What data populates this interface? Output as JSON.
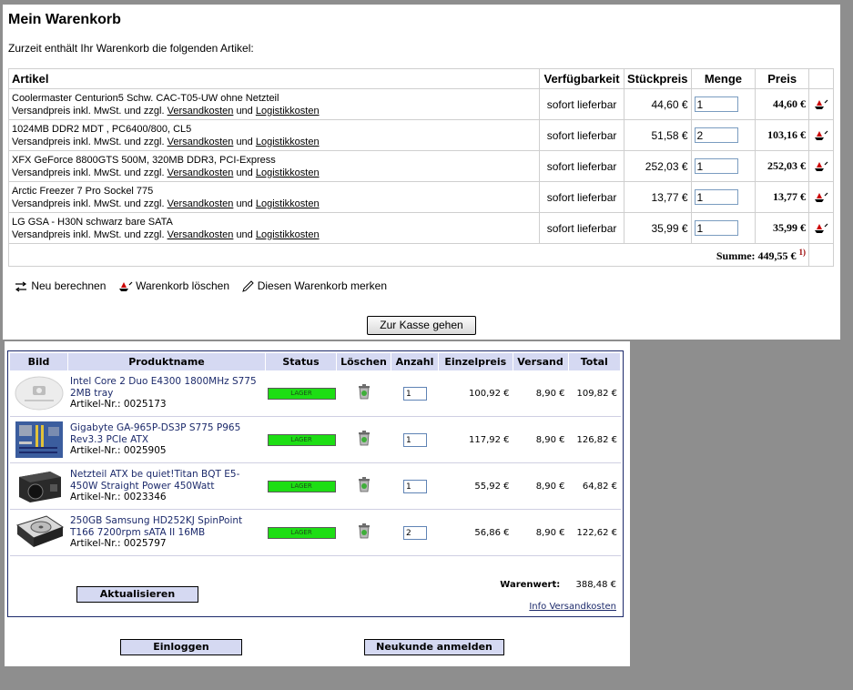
{
  "cart1": {
    "title": "Mein Warenkorb",
    "intro": "Zurzeit enthält Ihr Warenkorb die folgenden Artikel:",
    "headers": {
      "artikel": "Artikel",
      "avail": "Verfügbarkeit",
      "unit": "Stückpreis",
      "qty": "Menge",
      "price": "Preis"
    },
    "shipping_prefix": "Versandpreis inkl. MwSt. und zzgl.",
    "shipping_link": "Versandkosten",
    "and": "und",
    "logistics_link": "Logistikkosten",
    "items": [
      {
        "name": "Coolermaster Centurion5 Schw. CAC-T05-UW ohne Netzteil",
        "avail": "sofort lieferbar",
        "unit": "44,60 €",
        "qty": "1",
        "total": "44,60 €"
      },
      {
        "name": "1024MB DDR2 MDT , PC6400/800, CL5",
        "avail": "sofort lieferbar",
        "unit": "51,58 €",
        "qty": "2",
        "total": "103,16 €"
      },
      {
        "name": "XFX GeForce 8800GTS 500M, 320MB DDR3, PCI-Express",
        "avail": "sofort lieferbar",
        "unit": "252,03 €",
        "qty": "1",
        "total": "252,03 €"
      },
      {
        "name": "Arctic Freezer 7 Pro Sockel 775",
        "avail": "sofort lieferbar",
        "unit": "13,77 €",
        "qty": "1",
        "total": "13,77 €"
      },
      {
        "name": "LG GSA - H30N schwarz bare SATA",
        "avail": "sofort lieferbar",
        "unit": "35,99 €",
        "qty": "1",
        "total": "35,99 €"
      }
    ],
    "sum": "Summe: 449,55 €",
    "sum_note": "1)",
    "actions": {
      "recalc": "Neu berechnen",
      "clear": "Warenkorb löschen",
      "remember": "Diesen Warenkorb merken"
    },
    "checkout": "Zur Kasse gehen"
  },
  "cart2": {
    "headers": {
      "image": "Bild",
      "name": "Produktname",
      "status": "Status",
      "delete": "Löschen",
      "qty": "Anzahl",
      "unit": "Einzelpreis",
      "ship": "Versand",
      "total": "Total"
    },
    "items": [
      {
        "name": "Intel Core 2 Duo E4300 1800MHz S775 2MB tray",
        "article": "Artikel-Nr.: 0025173",
        "status": "LAGER",
        "qty": "1",
        "unit": "100,92 €",
        "ship": "8,90 €",
        "total": "109,82 €",
        "image": "no-image-placeholder"
      },
      {
        "name": "Gigabyte GA-965P-DS3P S775 P965 Rev3.3 PCIe ATX",
        "article": "Artikel-Nr.: 0025905",
        "status": "LAGER",
        "qty": "1",
        "unit": "117,92 €",
        "ship": "8,90 €",
        "total": "126,82 €",
        "image": "mainboard-photo"
      },
      {
        "name": "Netzteil ATX be quiet!Titan BQT E5-450W Straight Power 450Watt",
        "article": "Artikel-Nr.: 0023346",
        "status": "LAGER",
        "qty": "1",
        "unit": "55,92 €",
        "ship": "8,90 €",
        "total": "64,82 €",
        "image": "psu-photo"
      },
      {
        "name": "250GB Samsung HD252KJ SpinPoint T166 7200rpm sATA II 16MB",
        "article": "Artikel-Nr.: 0025797",
        "status": "LAGER",
        "qty": "2",
        "unit": "56,86 €",
        "ship": "8,90 €",
        "total": "122,62 €",
        "image": "hdd-photo"
      }
    ],
    "update_button": "Aktualisieren",
    "value_label": "Warenwert:",
    "value": "388,48 €",
    "info_link": "Info Versandkosten",
    "login_button": "Einloggen",
    "register_button": "Neukunde anmelden"
  },
  "colors": {
    "header_bg": "#d5d9f2",
    "link_blue": "#1c2a6b",
    "stock_green": "#1dde14",
    "delete_red": "#cc0000"
  }
}
